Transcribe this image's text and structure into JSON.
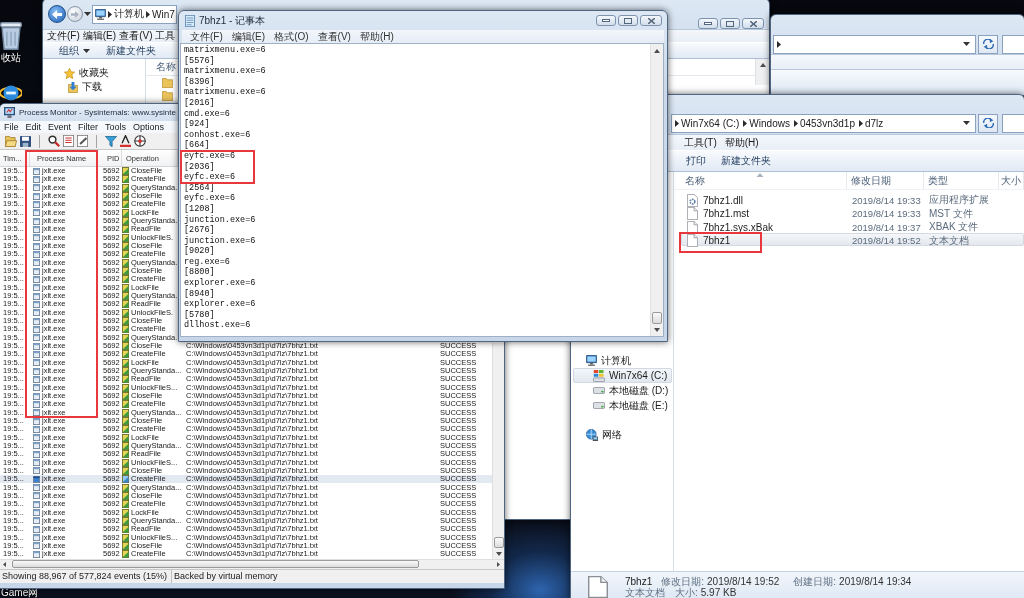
{
  "desktop": {
    "icons": [
      {
        "kind": "recycle-bin",
        "label": "收站"
      },
      {
        "kind": "browser"
      }
    ],
    "bottom_label": "Game网"
  },
  "explorer_back": {
    "breadcrumb": [
      {
        "kind": "computer"
      },
      {
        "label": "计算机"
      },
      {
        "label": "Win7"
      }
    ],
    "menu": [
      "文件(F)",
      "编辑(E)",
      "查看(V)",
      "工具"
    ],
    "toolbar": [
      {
        "label": "组织",
        "dropdown": true
      },
      {
        "label": "新建文件夹",
        "dropdown": false
      }
    ],
    "nav": [
      {
        "label": "收藏夹",
        "kind": "favorites",
        "selected": false,
        "children": [
          {
            "label": "下载",
            "kind": "downloads",
            "selected": false
          }
        ]
      }
    ],
    "columns": [
      "名称"
    ]
  },
  "notepad": {
    "title": "7bhz1 - 记事本",
    "menu": [
      "文件(F)",
      "编辑(E)",
      "格式(O)",
      "查看(V)",
      "帮助(H)"
    ],
    "lines": [
      "matrixmenu.exe=6",
      "[5576]",
      "matrixmenu.exe=6",
      "[8396]",
      "matrixmenu.exe=6",
      "[2016]",
      "cmd.exe=6",
      "[924]",
      "conhost.exe=6",
      "[664]",
      "eyfc.exe=6",
      "[2036]",
      "eyfc.exe=6",
      "[2564]",
      "eyfc.exe=6",
      "[1208]",
      "junction.exe=6",
      "[2676]",
      "junction.exe=6",
      "[9020]",
      "reg.exe=6",
      "[8800]",
      "explorer.exe=6",
      "[8940]",
      "explorer.exe=6",
      "[5780]",
      "dllhost.exe=6"
    ]
  },
  "process_monitor": {
    "title": "Process Monitor - Sysinternals: www.sysinte",
    "menu": [
      "File",
      "Edit",
      "Event",
      "Filter",
      "Tools",
      "Options"
    ],
    "columns": [
      "Tim...",
      "Process Name",
      "PID",
      "Operation"
    ],
    "rows": [
      {
        "time": "19:5...",
        "process": "jxlt.exe",
        "pid": "5692",
        "operation": "CloseFile",
        "selected": false
      },
      {
        "time": "19:5...",
        "process": "jxlt.exe",
        "pid": "5692",
        "operation": "CreateFile",
        "selected": false
      },
      {
        "time": "19:5...",
        "process": "jxlt.exe",
        "pid": "5692",
        "operation": "QueryStanda.",
        "selected": false
      },
      {
        "time": "19:5...",
        "process": "jxlt.exe",
        "pid": "5692",
        "operation": "CloseFile",
        "selected": false
      },
      {
        "time": "19:5...",
        "process": "jxlt.exe",
        "pid": "5692",
        "operation": "CreateFile",
        "selected": false
      },
      {
        "time": "19:5...",
        "process": "jxlt.exe",
        "pid": "5692",
        "operation": "LockFile",
        "selected": false
      },
      {
        "time": "19:5...",
        "process": "jxlt.exe",
        "pid": "5692",
        "operation": "QueryStanda.",
        "selected": false
      },
      {
        "time": "19:5...",
        "process": "jxlt.exe",
        "pid": "5692",
        "operation": "ReadFile",
        "selected": false
      },
      {
        "time": "19:5...",
        "process": "jxlt.exe",
        "pid": "5692",
        "operation": "UnlockFileS.",
        "selected": false
      },
      {
        "time": "19:5...",
        "process": "jxlt.exe",
        "pid": "5692",
        "operation": "CloseFile",
        "selected": false
      },
      {
        "time": "19:5...",
        "process": "jxlt.exe",
        "pid": "5692",
        "operation": "CreateFile",
        "selected": false
      },
      {
        "time": "19:5...",
        "process": "jxlt.exe",
        "pid": "5692",
        "operation": "QueryStanda.",
        "selected": false
      },
      {
        "time": "19:5...",
        "process": "jxlt.exe",
        "pid": "5692",
        "operation": "CloseFile",
        "selected": false
      },
      {
        "time": "19:5...",
        "process": "jxlt.exe",
        "pid": "5692",
        "operation": "CreateFile",
        "selected": false
      },
      {
        "time": "19:5...",
        "process": "jxlt.exe",
        "pid": "5692",
        "operation": "LockFile",
        "selected": false
      },
      {
        "time": "19:5...",
        "process": "jxlt.exe",
        "pid": "5692",
        "operation": "QueryStanda.",
        "selected": false
      },
      {
        "time": "19:5...",
        "process": "jxlt.exe",
        "pid": "5692",
        "operation": "ReadFile",
        "selected": false
      },
      {
        "time": "19:5...",
        "process": "jxlt.exe",
        "pid": "5692",
        "operation": "UnlockFileS.",
        "selected": false
      },
      {
        "time": "19:5...",
        "process": "jxlt.exe",
        "pid": "5692",
        "operation": "CloseFile",
        "selected": false
      },
      {
        "time": "19:5...",
        "process": "jxlt.exe",
        "pid": "5692",
        "operation": "CreateFile",
        "selected": false
      },
      {
        "time": "19:5...",
        "process": "jxlt.exe",
        "pid": "5692",
        "operation": "QueryStanda.",
        "selected": false
      },
      {
        "time": "19:5...",
        "process": "jxlt.exe",
        "pid": "5692",
        "operation": "CloseFile",
        "path": "C:\\Windows\\0453vn3d1p\\d7lz\\7bhz1.txt",
        "result": "SUCCESS",
        "selected": false
      },
      {
        "time": "19:5...",
        "process": "jxlt.exe",
        "pid": "5692",
        "operation": "CreateFile",
        "path": "C:\\Windows\\0453vn3d1p\\d7lz\\7bhz1.txt",
        "result": "SUCCESS",
        "selected": false
      },
      {
        "time": "19:5...",
        "process": "jxlt.exe",
        "pid": "5692",
        "operation": "LockFile",
        "path": "C:\\Windows\\0453vn3d1p\\d7lz\\7bhz1.txt",
        "result": "SUCCESS",
        "selected": false
      },
      {
        "time": "19:5...",
        "process": "jxlt.exe",
        "pid": "5692",
        "operation": "QueryStanda...",
        "path": "C:\\Windows\\0453vn3d1p\\d7lz\\7bhz1.txt",
        "result": "SUCCESS",
        "selected": false
      },
      {
        "time": "19:5...",
        "process": "jxlt.exe",
        "pid": "5692",
        "operation": "ReadFile",
        "path": "C:\\Windows\\0453vn3d1p\\d7lz\\7bhz1.txt",
        "result": "SUCCESS",
        "selected": false
      },
      {
        "time": "19:5...",
        "process": "jxlt.exe",
        "pid": "5692",
        "operation": "UnlockFileS...",
        "path": "C:\\Windows\\0453vn3d1p\\d7lz\\7bhz1.txt",
        "result": "SUCCESS",
        "selected": false
      },
      {
        "time": "19:5...",
        "process": "jxlt.exe",
        "pid": "5692",
        "operation": "CloseFile",
        "path": "C:\\Windows\\0453vn3d1p\\d7lz\\7bhz1.txt",
        "result": "SUCCESS",
        "selected": false
      },
      {
        "time": "19:5...",
        "process": "jxlt.exe",
        "pid": "5692",
        "operation": "CreateFile",
        "path": "C:\\Windows\\0453vn3d1p\\d7lz\\7bhz1.txt",
        "result": "SUCCESS",
        "selected": false
      },
      {
        "time": "19:5...",
        "process": "jxlt.exe",
        "pid": "5692",
        "operation": "QueryStanda...",
        "path": "C:\\Windows\\0453vn3d1p\\d7lz\\7bhz1.txt",
        "result": "SUCCESS",
        "selected": false
      },
      {
        "time": "19:5...",
        "process": "jxlt.exe",
        "pid": "5692",
        "operation": "CloseFile",
        "path": "C:\\Windows\\0453vn3d1p\\d7lz\\7bhz1.txt",
        "result": "SUCCESS",
        "selected": false
      },
      {
        "time": "19:5...",
        "process": "jxlt.exe",
        "pid": "5692",
        "operation": "CreateFile",
        "path": "C:\\Windows\\0453vn3d1p\\d7lz\\7bhz1.txt",
        "result": "SUCCESS",
        "selected": false
      },
      {
        "time": "19:5...",
        "process": "jxlt.exe",
        "pid": "5692",
        "operation": "LockFile",
        "path": "C:\\Windows\\0453vn3d1p\\d7lz\\7bhz1.txt",
        "result": "SUCCESS",
        "selected": false
      },
      {
        "time": "19:5...",
        "process": "jxlt.exe",
        "pid": "5692",
        "operation": "QueryStanda...",
        "path": "C:\\Windows\\0453vn3d1p\\d7lz\\7bhz1.txt",
        "result": "SUCCESS",
        "selected": false
      },
      {
        "time": "19:5...",
        "process": "jxlt.exe",
        "pid": "5692",
        "operation": "ReadFile",
        "path": "C:\\Windows\\0453vn3d1p\\d7lz\\7bhz1.txt",
        "result": "SUCCESS",
        "selected": false
      },
      {
        "time": "19:5...",
        "process": "jxlt.exe",
        "pid": "5692",
        "operation": "UnlockFileS...",
        "path": "C:\\Windows\\0453vn3d1p\\d7lz\\7bhz1.txt",
        "result": "SUCCESS",
        "selected": false
      },
      {
        "time": "19:5...",
        "process": "jxlt.exe",
        "pid": "5692",
        "operation": "CloseFile",
        "path": "C:\\Windows\\0453vn3d1p\\d7lz\\7bhz1.txt",
        "result": "SUCCESS",
        "selected": false
      },
      {
        "time": "19:5...",
        "process": "jxlt.exe",
        "pid": "5692",
        "operation": "CreateFile",
        "path": "C:\\Windows\\0453vn3d1p\\d7lz\\7bhz1.txt",
        "result": "SUCCESS",
        "selected": true
      },
      {
        "time": "19:5...",
        "process": "jxlt.exe",
        "pid": "5692",
        "operation": "QueryStanda...",
        "path": "C:\\Windows\\0453vn3d1p\\d7lz\\7bhz1.txt",
        "result": "SUCCESS",
        "selected": false
      },
      {
        "time": "19:5...",
        "process": "jxlt.exe",
        "pid": "5692",
        "operation": "CloseFile",
        "path": "C:\\Windows\\0453vn3d1p\\d7lz\\7bhz1.txt",
        "result": "SUCCESS",
        "selected": false
      },
      {
        "time": "19:5...",
        "process": "jxlt.exe",
        "pid": "5692",
        "operation": "CreateFile",
        "path": "C:\\Windows\\0453vn3d1p\\d7lz\\7bhz1.txt",
        "result": "SUCCESS",
        "selected": false
      },
      {
        "time": "19:5...",
        "process": "jxlt.exe",
        "pid": "5692",
        "operation": "LockFile",
        "path": "C:\\Windows\\0453vn3d1p\\d7lz\\7bhz1.txt",
        "result": "SUCCESS",
        "selected": false
      },
      {
        "time": "19:5...",
        "process": "jxlt.exe",
        "pid": "5692",
        "operation": "QueryStanda...",
        "path": "C:\\Windows\\0453vn3d1p\\d7lz\\7bhz1.txt",
        "result": "SUCCESS",
        "selected": false
      },
      {
        "time": "19:5...",
        "process": "jxlt.exe",
        "pid": "5692",
        "operation": "ReadFile",
        "path": "C:\\Windows\\0453vn3d1p\\d7lz\\7bhz1.txt",
        "result": "SUCCESS",
        "selected": false
      },
      {
        "time": "19:5...",
        "process": "jxlt.exe",
        "pid": "5692",
        "operation": "UnlockFileS...",
        "path": "C:\\Windows\\0453vn3d1p\\d7lz\\7bhz1.txt",
        "result": "SUCCESS",
        "selected": false
      },
      {
        "time": "19:5...",
        "process": "jxlt.exe",
        "pid": "5692",
        "operation": "CloseFile",
        "path": "C:\\Windows\\0453vn3d1p\\d7lz\\7bhz1.txt",
        "result": "SUCCESS",
        "selected": false
      },
      {
        "time": "19:5...",
        "process": "jxlt.exe",
        "pid": "5692",
        "operation": "CreateFile",
        "path": "C:\\Windows\\0453vn3d1p\\d7lz\\7bhz1.txt",
        "result": "SUCCESS",
        "selected": false
      }
    ],
    "status": [
      "Showing 88,967 of 577,824 events (15%)",
      "Backed by virtual memory"
    ]
  },
  "explorer": {
    "breadcrumb": [
      {
        "label": "Win7x64 (C:)"
      },
      {
        "label": "Windows"
      },
      {
        "label": "0453vn3d1p"
      },
      {
        "label": "d7lz"
      }
    ],
    "menu": [
      "工具(T)",
      "帮助(H)"
    ],
    "toolbar": [
      {
        "label": "打印",
        "dropdown": false
      },
      {
        "label": "新建文件夹",
        "dropdown": false
      }
    ],
    "columns": [
      {
        "label": "名称",
        "sorted": true
      },
      {
        "label": "修改日期",
        "sorted": false
      },
      {
        "label": "类型",
        "sorted": false
      },
      {
        "label": "大小",
        "sorted": false
      }
    ],
    "files": [
      {
        "name": "7bhz1.dll",
        "kind": "dll",
        "modified": "2019/8/14 19:33",
        "type": "应用程序扩展",
        "selected": false
      },
      {
        "name": "7bhz1.mst",
        "kind": "file",
        "modified": "2019/8/14 19:33",
        "type": "MST 文件",
        "selected": false
      },
      {
        "name": "7bhz1.sys.xBak",
        "kind": "file",
        "modified": "2019/8/14 19:37",
        "type": "XBAK 文件",
        "selected": false
      },
      {
        "name": "7bhz1",
        "kind": "file",
        "modified": "2019/8/14 19:52",
        "type": "文本文档",
        "selected": true
      }
    ],
    "nav": [
      {
        "label": "计算机",
        "kind": "computer",
        "selected": false,
        "children": [
          {
            "label": "Win7x64 (C:)",
            "kind": "system-drive",
            "selected": true
          },
          {
            "label": "本地磁盘 (D:)",
            "kind": "drive",
            "selected": false
          },
          {
            "label": "本地磁盘 (E:)",
            "kind": "drive",
            "selected": false
          }
        ]
      },
      {
        "label": "网络",
        "kind": "network",
        "selected": false
      }
    ],
    "details": {
      "name": "7bhz1",
      "type": "文本文档",
      "fields": [
        {
          "label": "修改日期:",
          "value": "2019/8/14 19:52"
        },
        {
          "label": "创建日期:",
          "value": "2019/8/14 19:34"
        },
        {
          "label": "大小:",
          "value": "5.97 KB"
        }
      ]
    }
  }
}
